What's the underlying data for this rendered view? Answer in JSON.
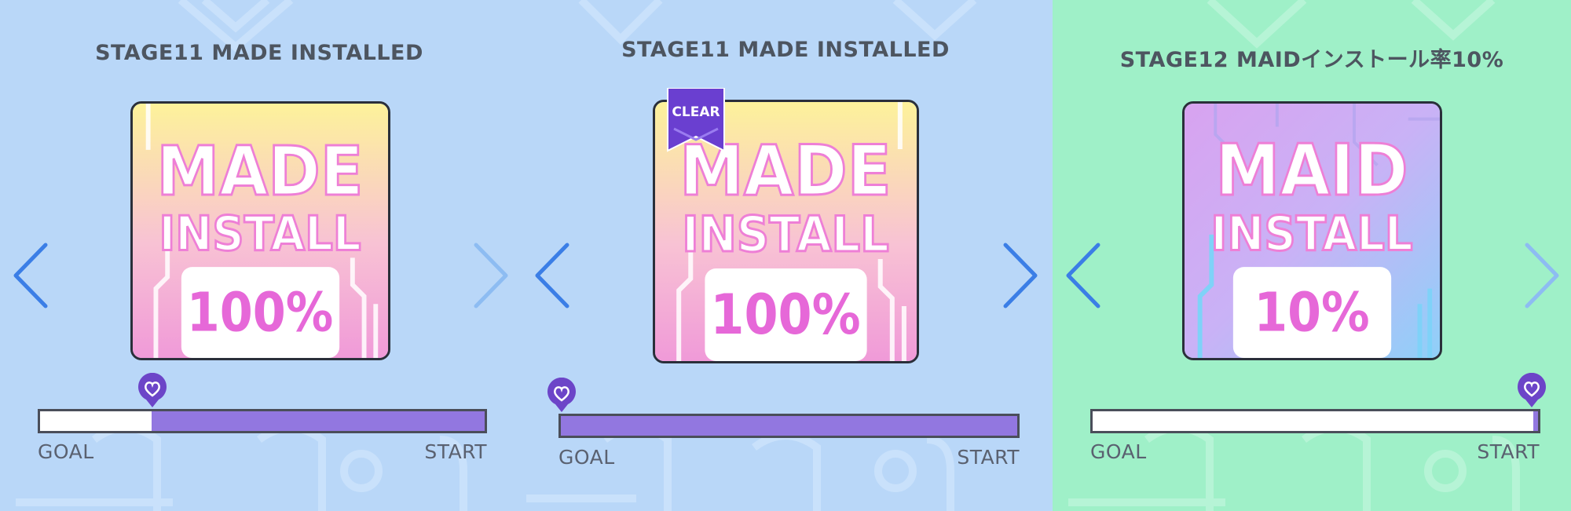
{
  "panels": [
    {
      "title": "STAGE11 MADE INSTALLED",
      "background": "#b9d7f8",
      "art": {
        "line1": "MADE",
        "line2": "INSTALL",
        "percent_label": "100%",
        "theme": "yellow-pink"
      },
      "clear_badge": "",
      "progress": {
        "goal_label": "GOAL",
        "start_label": "START",
        "progress_fraction": 0.75,
        "fill_color": "#9277e0"
      },
      "left_arrow": "chevron-left-icon",
      "right_arrow": "chevron-right-icon"
    },
    {
      "title": "STAGE11 MADE INSTALLED",
      "background": "#b9d7f8",
      "art": {
        "line1": "MADE",
        "line2": "INSTALL",
        "percent_label": "100%",
        "theme": "yellow-pink"
      },
      "clear_badge": "CLEAR",
      "progress": {
        "goal_label": "GOAL",
        "start_label": "START",
        "progress_fraction": 1.0,
        "fill_color": "#9277e0"
      },
      "left_arrow": "chevron-left-icon",
      "right_arrow": "chevron-right-icon"
    },
    {
      "title": "STAGE12 MAIDインストール率10%",
      "background": "#9ff0c8",
      "art": {
        "line1": "MAID",
        "line2": "INSTALL",
        "percent_label": "10%",
        "theme": "blue-pink"
      },
      "clear_badge": "",
      "progress": {
        "goal_label": "GOAL",
        "start_label": "START",
        "progress_fraction": 0.01,
        "fill_color": "#9277e0"
      },
      "left_arrow": "chevron-left-icon",
      "right_arrow": "chevron-right-icon"
    }
  ],
  "colors": {
    "arrow_dark": "#3b7ee6",
    "arrow_light": "#8dbcf2",
    "marker": "#6c45c8",
    "ribbon": "#6a3fd0"
  }
}
